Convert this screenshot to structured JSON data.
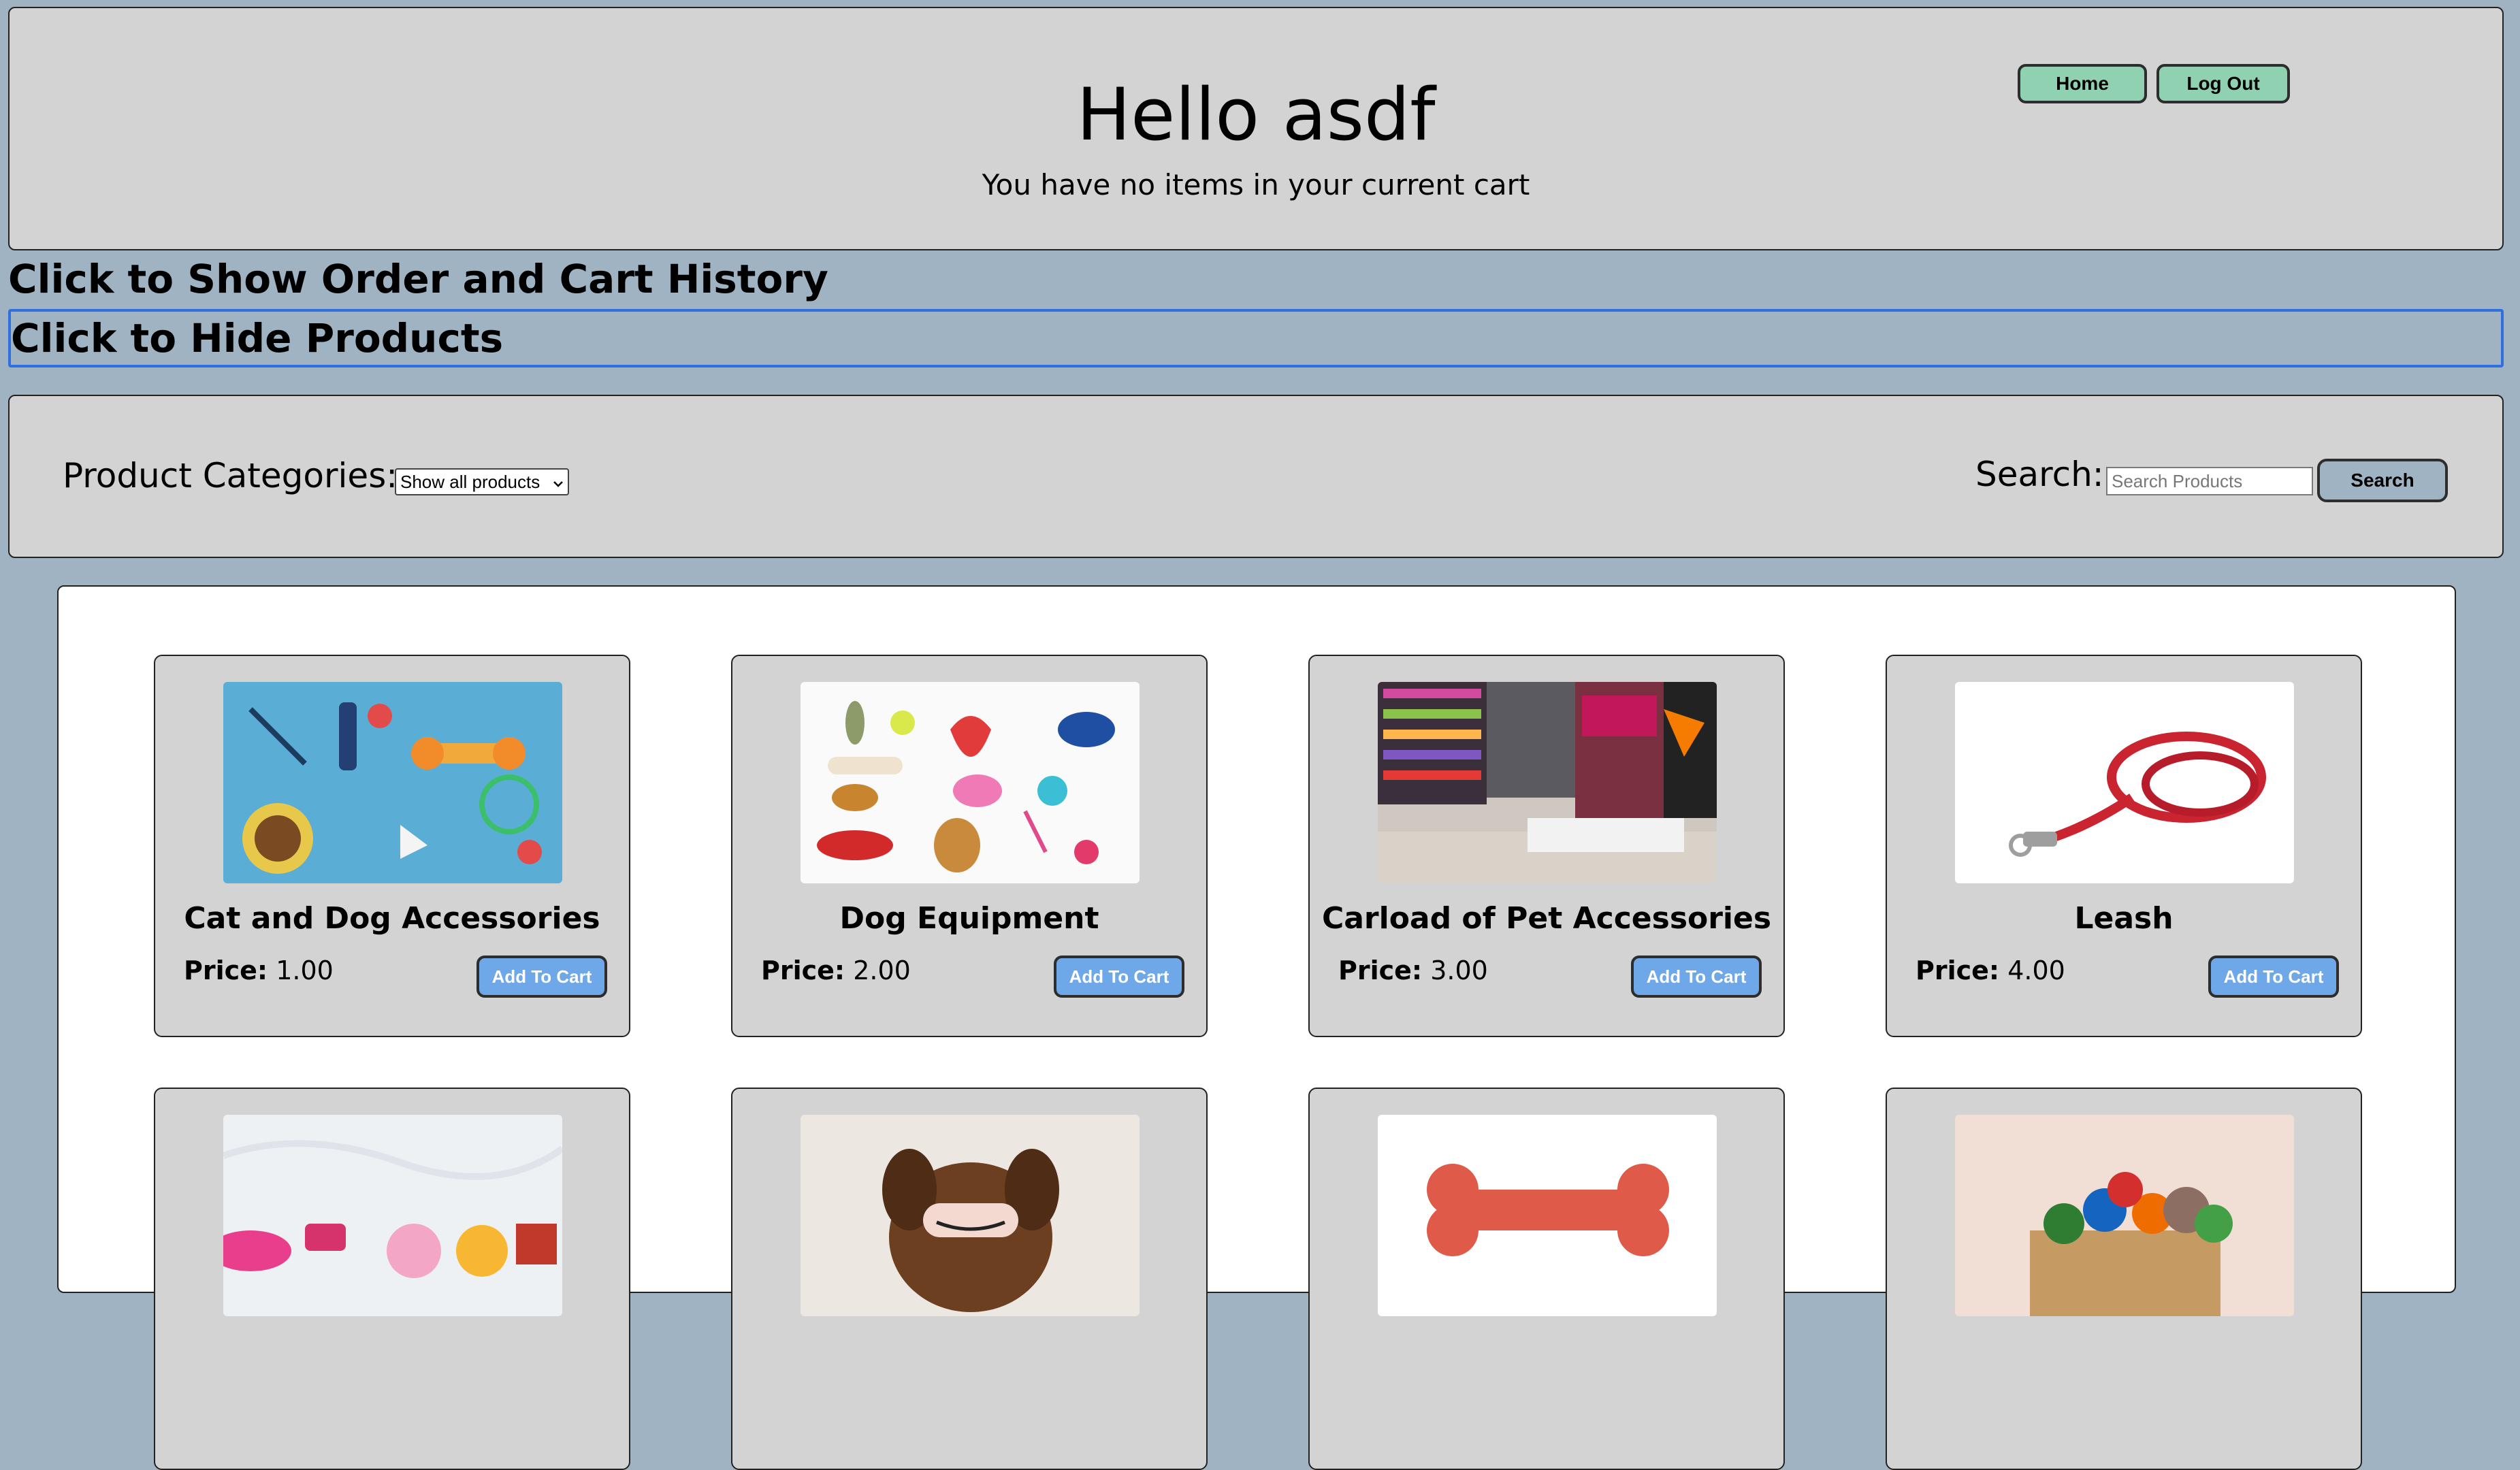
{
  "header": {
    "greeting": "Hello asdf",
    "cart_status": "You have no items in your current cart",
    "home_label": "Home",
    "logout_label": "Log Out"
  },
  "toggles": {
    "history": "Click to Show Order and Cart History",
    "products": "Click to Hide Products"
  },
  "filters": {
    "categories_label": "Product Categories:",
    "category_selected": "Show all products",
    "search_label": "Search:",
    "search_placeholder": "Search Products",
    "search_button": "Search"
  },
  "products": [
    {
      "name": "Cat and Dog Accessories",
      "price_label": "Price:",
      "price": "1.00",
      "button": "Add To Cart",
      "image": "pet-accessories-blue-image"
    },
    {
      "name": "Dog Equipment",
      "price_label": "Price:",
      "price": "2.00",
      "button": "Add To Cart",
      "image": "dog-toys-white-image"
    },
    {
      "name": "Carload of Pet Accessories",
      "price_label": "Price:",
      "price": "3.00",
      "button": "Add To Cart",
      "image": "pet-store-aisle-image"
    },
    {
      "name": "Leash",
      "price_label": "Price:",
      "price": "4.00",
      "button": "Add To Cart",
      "image": "red-leash-image"
    },
    {
      "name": "",
      "image": "pet-toys-marble-image"
    },
    {
      "name": "",
      "image": "sleeping-dog-image"
    },
    {
      "name": "",
      "image": "orange-bone-image"
    },
    {
      "name": "",
      "image": "toy-box-image"
    }
  ],
  "colors": {
    "page_bg": "#9fb3c3",
    "panel_bg": "#d3d3d3",
    "nav_button": "#8fd1b1",
    "add_button": "#6fa8e8"
  }
}
